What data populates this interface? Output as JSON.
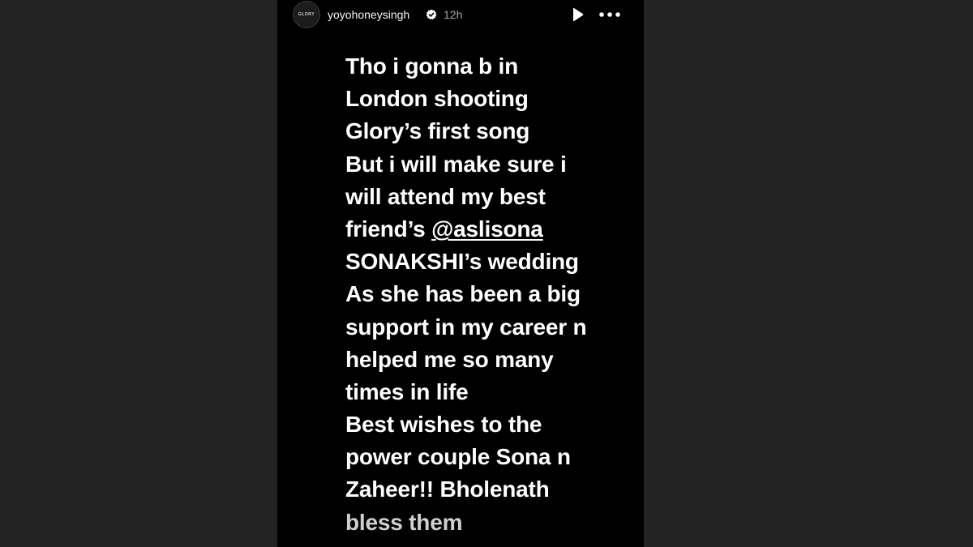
{
  "story": {
    "avatar_label": "GLORY",
    "username": "yoyohoneysingh",
    "timestamp": "12h",
    "icons": {
      "verified": "verified-badge-icon",
      "play": "play-icon",
      "more": "more-options-icon"
    },
    "lines": [
      "Tho i gonna b in",
      "London shooting",
      "Glory’s first song",
      "But i will make sure i",
      "will attend my best",
      "friend’s ",
      "SONAKSHI’s wedding",
      "As she has been a big",
      "support in my career n",
      "helped me so many",
      "times in life",
      "Best wishes to the",
      "power couple Sona n",
      "Zaheer!! Bholenath",
      "bless them"
    ],
    "mention": "@aslisona"
  },
  "colors": {
    "page_background": "#232323",
    "story_background": "#000000",
    "text": "#ffffff",
    "meta_text": "#a8a8a8"
  }
}
